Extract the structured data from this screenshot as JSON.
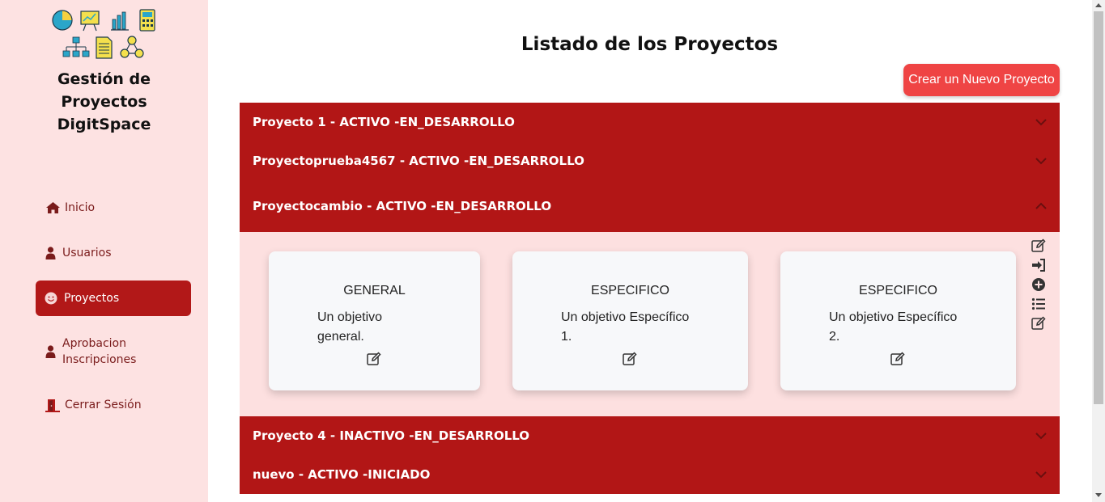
{
  "brand": {
    "line1": "Gestión de",
    "line2": "Proyectos",
    "line3": "DigitSpace"
  },
  "sidebar": {
    "items": [
      {
        "label": "Inicio",
        "icon": "home-icon"
      },
      {
        "label": "Usuarios",
        "icon": "user-icon"
      },
      {
        "label": "Proyectos",
        "icon": "smile-icon",
        "active": true
      },
      {
        "label": "Aprobacion",
        "label2": "Inscripciones",
        "icon": "user-icon"
      },
      {
        "label": "Cerrar Sesión",
        "icon": "door-exit-icon"
      }
    ]
  },
  "main": {
    "title": "Listado de los Proyectos",
    "new_button": "Crear un Nuevo Proyecto",
    "projects": [
      {
        "label": "Proyecto 1 - ACTIVO -EN_DESARROLLO",
        "expanded": false
      },
      {
        "label": "Proyectoprueba4567 - ACTIVO -EN_DESARROLLO",
        "expanded": false
      },
      {
        "label": "Proyectocambio - ACTIVO -EN_DESARROLLO",
        "expanded": true
      },
      {
        "label": "Proyecto 4 - INACTIVO -EN_DESARROLLO",
        "expanded": false
      },
      {
        "label": "nuevo - ACTIVO -INICIADO",
        "expanded": false
      }
    ],
    "objectives": [
      {
        "type": "GENERAL",
        "desc_line1": "Un objetivo",
        "desc_line2": "general."
      },
      {
        "type": "ESPECIFICO",
        "desc_line1": "Un objetivo Específico",
        "desc_line2": "1."
      },
      {
        "type": "ESPECIFICO",
        "desc_line1": "Un objetivo Específico",
        "desc_line2": "2."
      }
    ],
    "tools": [
      "edit-icon",
      "sign-in-icon",
      "plus-circle-icon",
      "list-icon",
      "edit-icon"
    ]
  },
  "colors": {
    "sidebar_bg": "#fde2e2",
    "accent": "#b21616",
    "button": "#ef4444",
    "panel_bg": "#fde0e0"
  }
}
